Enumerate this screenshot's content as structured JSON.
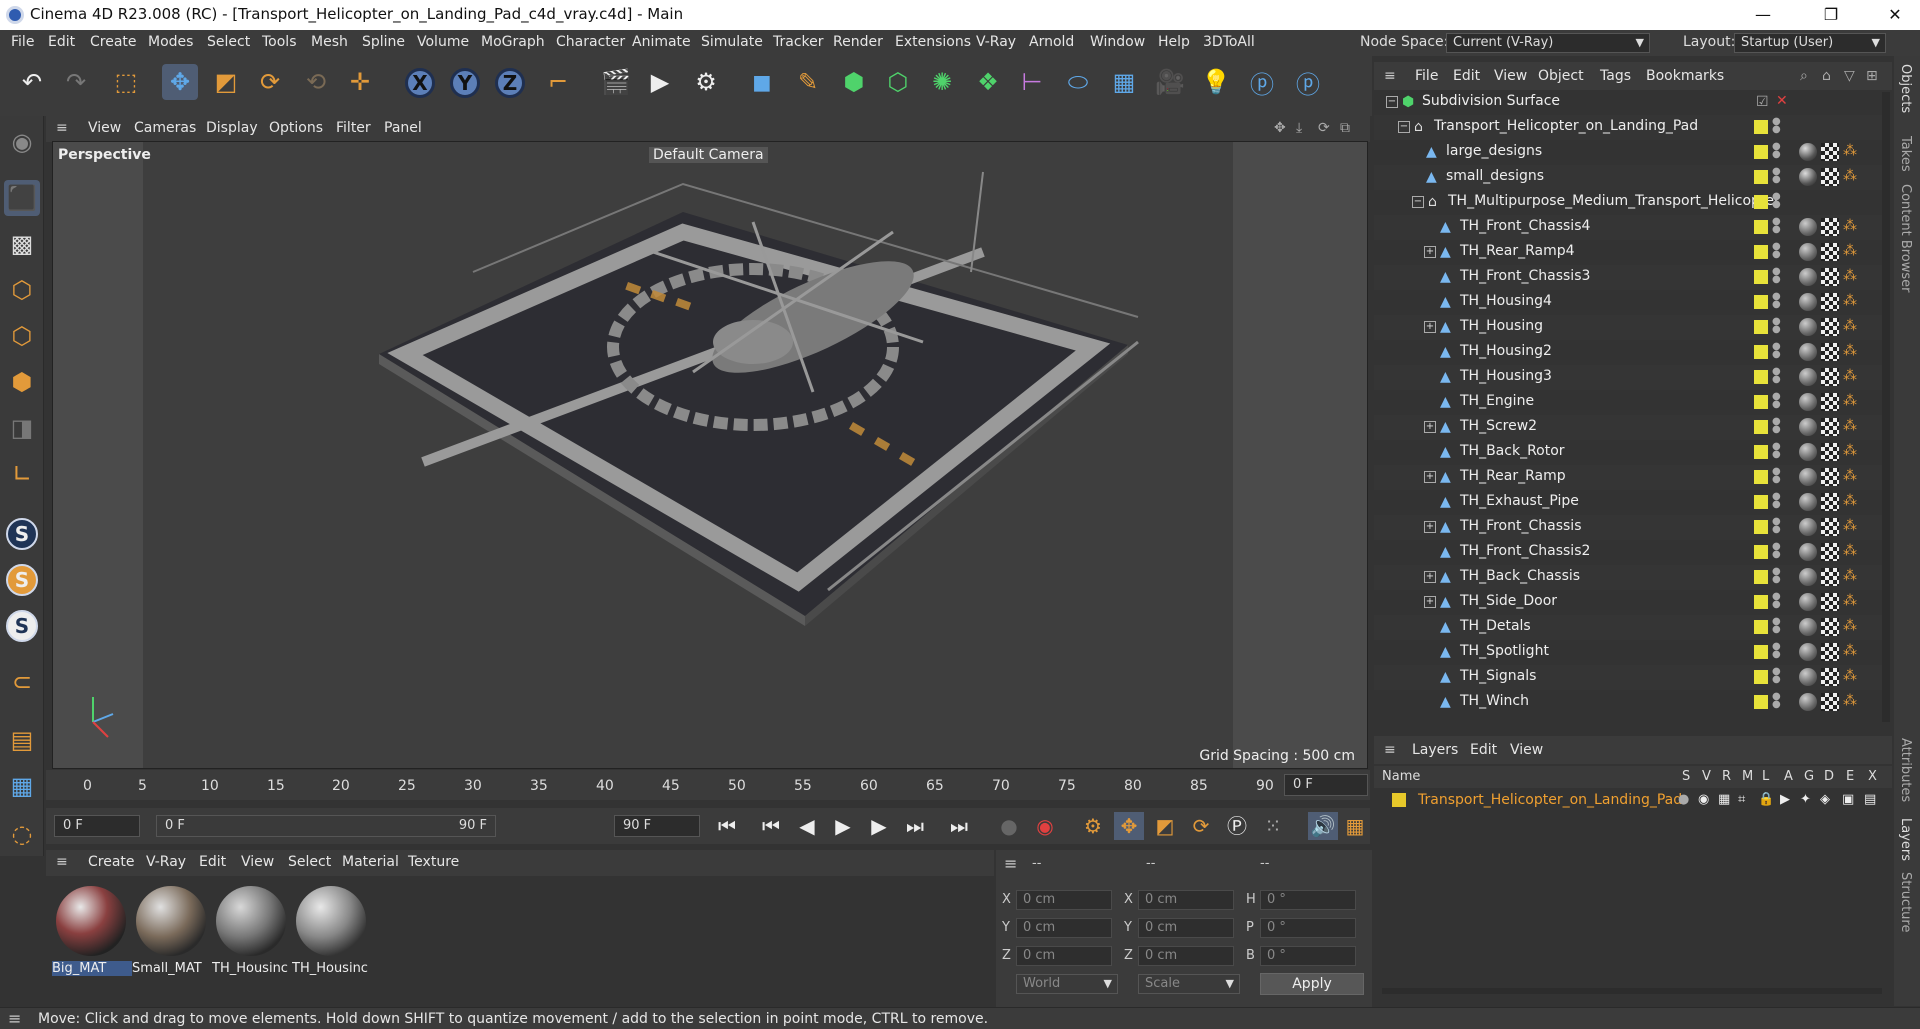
{
  "window": {
    "title": "Cinema 4D R23.008 (RC) - [Transport_Helicopter_on_Landing_Pad_c4d_vray.c4d] - Main"
  },
  "menubar": {
    "items": [
      "File",
      "Edit",
      "Create",
      "Modes",
      "Select",
      "Tools",
      "Mesh",
      "Spline",
      "Volume",
      "MoGraph",
      "Character",
      "Animate",
      "Simulate",
      "Tracker",
      "Render",
      "Extensions",
      "V-Ray",
      "Arnold",
      "Window",
      "Help",
      "3DToAll"
    ],
    "node_space_label": "Node Space:",
    "node_space_value": "Current (V-Ray)",
    "layout_label": "Layout:",
    "layout_value": "Startup (User)"
  },
  "viewport_menu": [
    "View",
    "Cameras",
    "Display",
    "Options",
    "Filter",
    "Panel"
  ],
  "viewport": {
    "label": "Perspective",
    "camera": "Default Camera",
    "grid_spacing": "Grid Spacing : 500 cm"
  },
  "timeline": {
    "ticks": [
      "0",
      "5",
      "10",
      "15",
      "20",
      "25",
      "30",
      "35",
      "40",
      "45",
      "50",
      "55",
      "60",
      "65",
      "70",
      "75",
      "80",
      "85",
      "90"
    ],
    "current_frame": "0 F"
  },
  "playback": {
    "start": "0 F",
    "range_start": "0 F",
    "range_end": "90 F",
    "end": "90 F"
  },
  "material_menu": [
    "Create",
    "V-Ray",
    "Edit",
    "View",
    "Select",
    "Material",
    "Texture"
  ],
  "materials": [
    {
      "name": "Big_MAT"
    },
    {
      "name": "Small_MAT"
    },
    {
      "name": "TH_Housinc"
    },
    {
      "name": "TH_Housinc"
    }
  ],
  "coordinates": {
    "headers": [
      "--",
      "--",
      "--"
    ],
    "rows": [
      {
        "a": "X",
        "av": "0 cm",
        "b": "X",
        "bv": "0 cm",
        "c": "H",
        "cv": "0 °"
      },
      {
        "a": "Y",
        "av": "0 cm",
        "b": "Y",
        "bv": "0 cm",
        "c": "P",
        "cv": "0 °"
      },
      {
        "a": "Z",
        "av": "0 cm",
        "b": "Z",
        "bv": "0 cm",
        "c": "B",
        "cv": "0 °"
      }
    ],
    "space": "World",
    "mode": "Scale",
    "apply_label": "Apply"
  },
  "status": {
    "message": "Move: Click and drag to move elements. Hold down SHIFT to quantize movement / add to the selection in point mode, CTRL to remove."
  },
  "object_menu": [
    "File",
    "Edit",
    "View",
    "Object",
    "Tags",
    "Bookmarks"
  ],
  "objects": [
    {
      "name": "Subdivision Surface",
      "toggle": "−"
    },
    {
      "name": "Transport_Helicopter_on_Landing_Pad",
      "toggle": "−"
    },
    {
      "name": "large_designs",
      "toggle": ""
    },
    {
      "name": "small_designs",
      "toggle": ""
    },
    {
      "name": "TH_Multipurpose_Medium_Transport_Helicopter",
      "toggle": "−"
    },
    {
      "name": "TH_Front_Chassis4",
      "toggle": ""
    },
    {
      "name": "TH_Rear_Ramp4",
      "toggle": "+"
    },
    {
      "name": "TH_Front_Chassis3",
      "toggle": ""
    },
    {
      "name": "TH_Housing4",
      "toggle": ""
    },
    {
      "name": "TH_Housing",
      "toggle": "+"
    },
    {
      "name": "TH_Housing2",
      "toggle": ""
    },
    {
      "name": "TH_Housing3",
      "toggle": ""
    },
    {
      "name": "TH_Engine",
      "toggle": ""
    },
    {
      "name": "TH_Screw2",
      "toggle": "+"
    },
    {
      "name": "TH_Back_Rotor",
      "toggle": ""
    },
    {
      "name": "TH_Rear_Ramp",
      "toggle": "+"
    },
    {
      "name": "TH_Exhaust_Pipe",
      "toggle": ""
    },
    {
      "name": "TH_Front_Chassis",
      "toggle": "+"
    },
    {
      "name": "TH_Front_Chassis2",
      "toggle": ""
    },
    {
      "name": "TH_Back_Chassis",
      "toggle": "+"
    },
    {
      "name": "TH_Side_Door",
      "toggle": "+"
    },
    {
      "name": "TH_Detals",
      "toggle": ""
    },
    {
      "name": "TH_Spotlight",
      "toggle": ""
    },
    {
      "name": "TH_Signals",
      "toggle": ""
    },
    {
      "name": "TH_Winch",
      "toggle": ""
    }
  ],
  "layer_menu": [
    "Layers",
    "Edit",
    "View"
  ],
  "layer_headers": [
    "Name",
    "S",
    "V",
    "R",
    "M",
    "L",
    "A",
    "G",
    "D",
    "E",
    "X"
  ],
  "layers": [
    {
      "name": "Transport_Helicopter_on_Landing_Pad",
      "color": "#e7c82a"
    }
  ],
  "side_tabs": [
    "Objects",
    "Takes",
    "Content Browser",
    "Attributes",
    "Layers",
    "Structure"
  ],
  "colors": {
    "accent": "#e29a3a",
    "layer_text": "#f0a030",
    "layer_yellow": "#e7e23a"
  }
}
